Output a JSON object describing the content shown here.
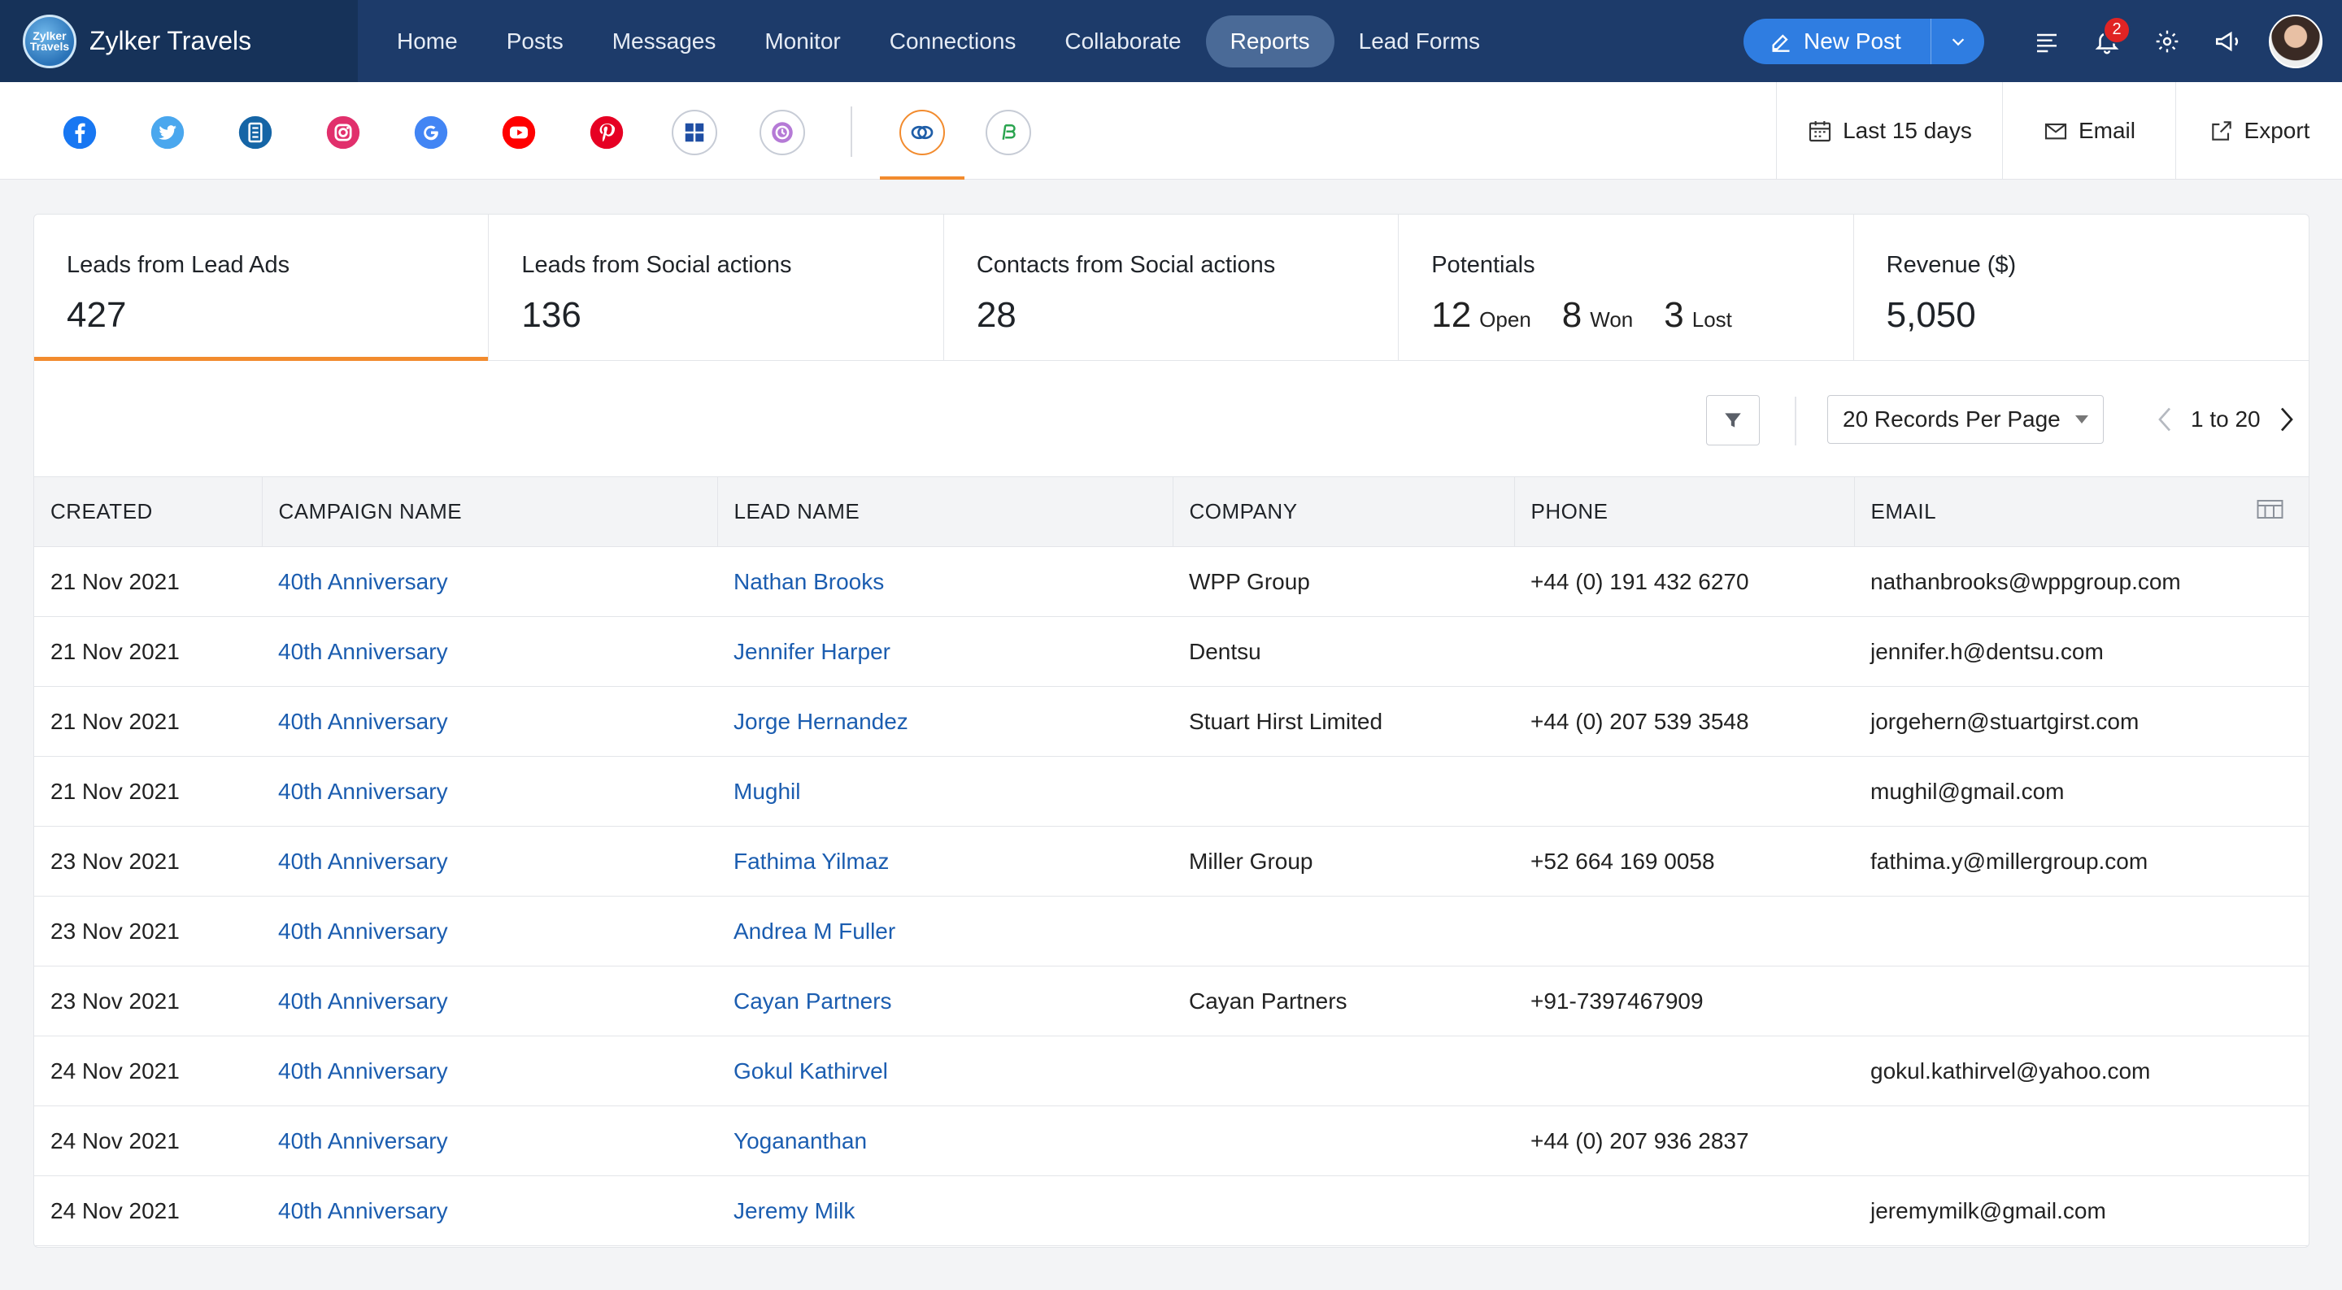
{
  "app": {
    "name": "Zylker Travels",
    "logo_text": "Zylker Travels"
  },
  "nav": {
    "items": [
      {
        "label": "Home"
      },
      {
        "label": "Posts"
      },
      {
        "label": "Messages"
      },
      {
        "label": "Monitor"
      },
      {
        "label": "Connections"
      },
      {
        "label": "Collaborate"
      },
      {
        "label": "Reports"
      },
      {
        "label": "Lead Forms"
      }
    ],
    "active": "Reports"
  },
  "header": {
    "new_post_label": "New Post",
    "notification_count": "2"
  },
  "channels": [
    "facebook-icon",
    "twitter-icon",
    "linkedin-page-icon",
    "instagram-icon",
    "google-icon",
    "youtube-icon",
    "pinterest-icon",
    "tiktok-grid-icon",
    "zoho-icon",
    "crm-link-icon",
    "bigin-icon"
  ],
  "tools": {
    "date_range": "Last 15 days",
    "email": "Email",
    "export": "Export"
  },
  "stats": {
    "lead_ads": {
      "label": "Leads from Lead Ads",
      "value": "427"
    },
    "social_actions": {
      "label": "Leads from Social actions",
      "value": "136"
    },
    "contacts": {
      "label": "Contacts from Social actions",
      "value": "28"
    },
    "potentials": {
      "label": "Potentials",
      "open": "12",
      "open_label": "Open",
      "won": "8",
      "won_label": "Won",
      "lost": "3",
      "lost_label": "Lost"
    },
    "revenue": {
      "label": "Revenue ($)",
      "value": "5,050"
    }
  },
  "controls": {
    "records_per_page": "20 Records Per Page",
    "range": "1 to 20"
  },
  "table": {
    "headers": [
      "CREATED",
      "CAMPAIGN NAME",
      "LEAD NAME",
      "COMPANY",
      "PHONE",
      "EMAIL"
    ],
    "rows": [
      [
        "21 Nov 2021",
        "40th Anniversary",
        "Nathan Brooks",
        "WPP Group",
        "+44 (0) 191 432 6270",
        "nathanbrooks@wppgroup.com"
      ],
      [
        "21 Nov 2021",
        "40th Anniversary",
        "Jennifer Harper",
        "Dentsu",
        "",
        "jennifer.h@dentsu.com"
      ],
      [
        "21 Nov 2021",
        "40th Anniversary",
        "Jorge Hernandez",
        "Stuart Hirst Limited",
        "+44 (0) 207 539 3548",
        "jorgehern@stuartgirst.com"
      ],
      [
        "21 Nov 2021",
        "40th Anniversary",
        "Mughil",
        "",
        "",
        "mughil@gmail.com"
      ],
      [
        "23 Nov 2021",
        "40th Anniversary",
        "Fathima Yilmaz",
        "Miller Group",
        "+52 664 169 0058",
        "fathima.y@millergroup.com"
      ],
      [
        "23 Nov 2021",
        "40th Anniversary",
        "Andrea M Fuller",
        "",
        "",
        ""
      ],
      [
        "23 Nov 2021",
        "40th Anniversary",
        "Cayan Partners",
        "Cayan Partners",
        "+91-7397467909",
        ""
      ],
      [
        "24 Nov 2021",
        "40th Anniversary",
        "Gokul Kathirvel",
        "",
        "",
        "gokul.kathirvel@yahoo.com"
      ],
      [
        "24 Nov 2021",
        "40th Anniversary",
        "Yogananthan",
        "",
        "+44 (0) 207 936 2837",
        ""
      ],
      [
        "24 Nov 2021",
        "40th Anniversary",
        "Jeremy Milk",
        "",
        "",
        "jeremymilk@gmail.com"
      ]
    ]
  },
  "colors": {
    "navbar": "#1d3b6a",
    "accent": "#f28b2e",
    "link": "#1b5db0",
    "primary_button": "#2f7de1"
  }
}
